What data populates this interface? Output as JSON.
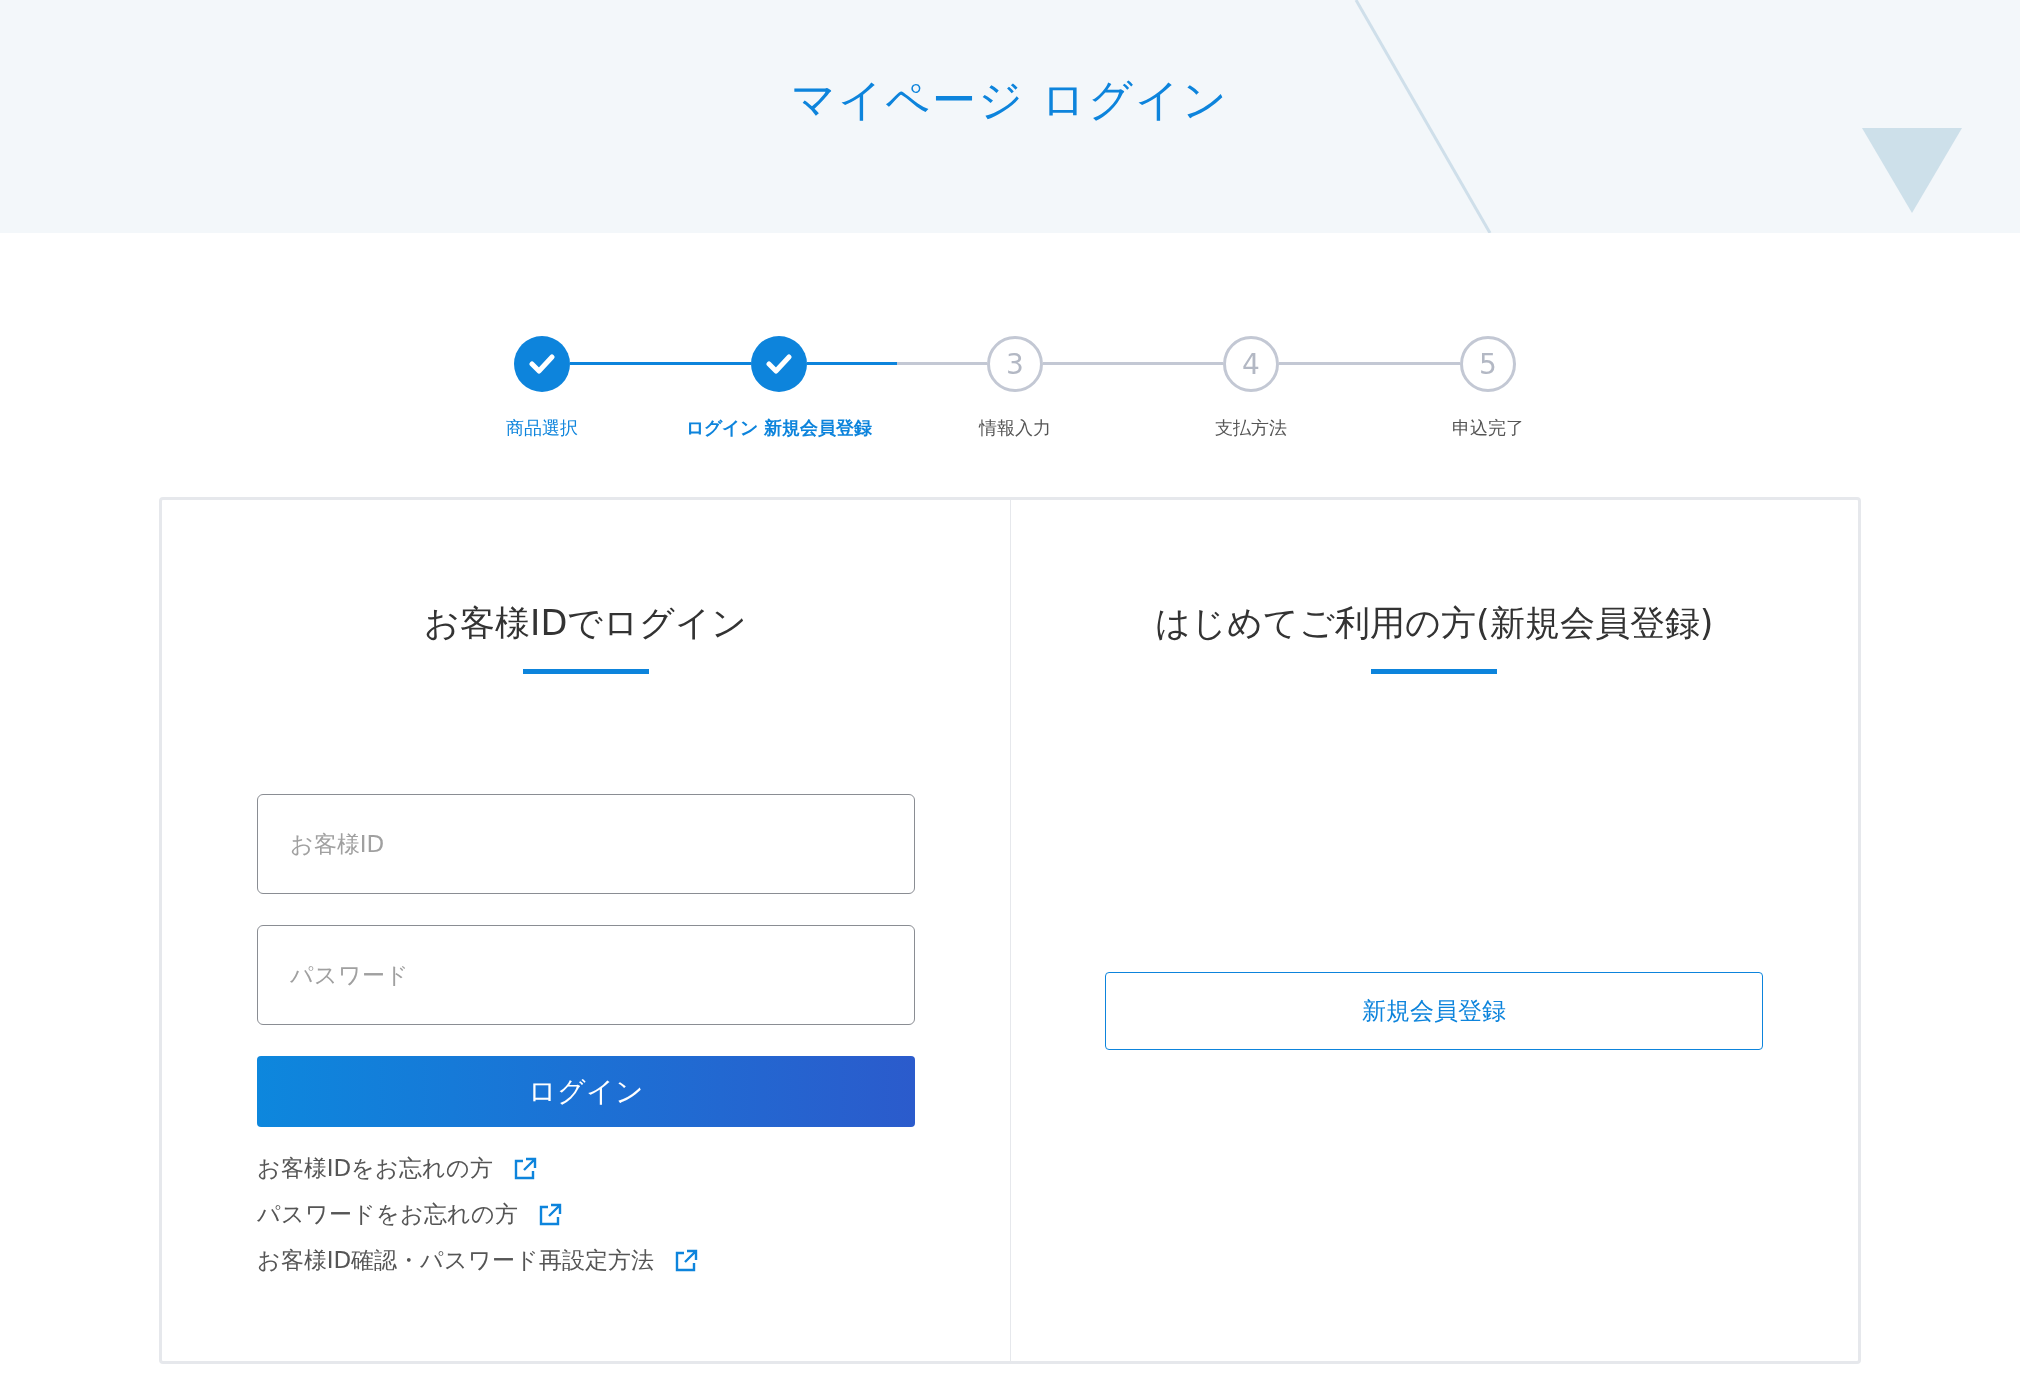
{
  "header": {
    "title": "マイページ ログイン"
  },
  "steps": [
    {
      "label": "商品選択",
      "completed": true,
      "selected": false
    },
    {
      "label": "ログイン 新規会員登録",
      "completed": true,
      "selected": true
    },
    {
      "number": "3",
      "label": "情報入力",
      "completed": false,
      "selected": false
    },
    {
      "number": "4",
      "label": "支払方法",
      "completed": false,
      "selected": false
    },
    {
      "number": "5",
      "label": "申込完了",
      "completed": false,
      "selected": false
    }
  ],
  "login": {
    "heading": "お客様IDでログイン",
    "id_field": {
      "placeholder": "お客様ID"
    },
    "password_field": {
      "placeholder": "パスワード"
    },
    "button": "ログイン",
    "links": [
      "お客様IDをお忘れの方",
      "パスワードをお忘れの方",
      "お客様ID確認・パスワード再設定方法"
    ]
  },
  "register": {
    "heading": "はじめてご利用の方(新規会員登録)",
    "button": "新規会員登録"
  }
}
